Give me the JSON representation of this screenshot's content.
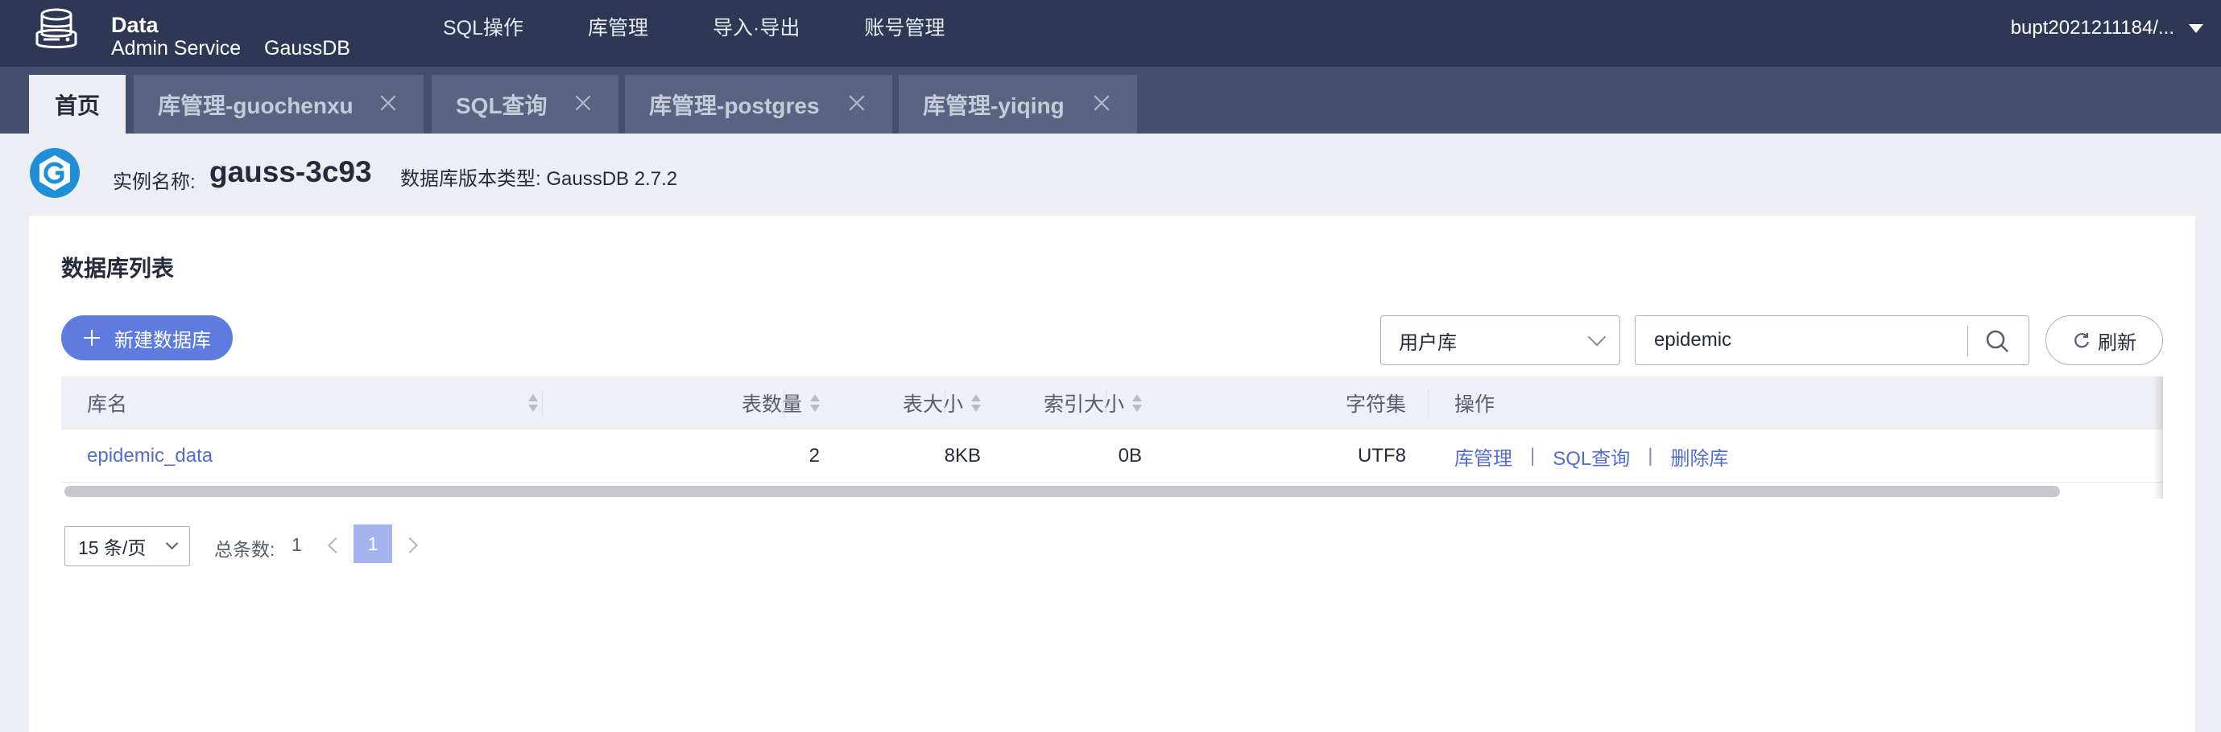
{
  "header": {
    "logo_line1": "Data",
    "logo_line2": "Admin Service",
    "product": "GaussDB",
    "nav": [
      {
        "label": "SQL操作"
      },
      {
        "label": "库管理"
      },
      {
        "label": "导入·导出"
      },
      {
        "label": "账号管理"
      }
    ],
    "user": "bupt2021211184/..."
  },
  "tabs": [
    {
      "label": "首页",
      "active": true
    },
    {
      "label": "库管理-guochenxu"
    },
    {
      "label": "SQL查询"
    },
    {
      "label": "库管理-postgres"
    },
    {
      "label": "库管理-yiqing"
    }
  ],
  "instance": {
    "name_label": "实例名称:",
    "name": "gauss-3c93",
    "version": "数据库版本类型: GaussDB 2.7.2"
  },
  "card": {
    "title": "数据库列表",
    "new_button": "新建数据库",
    "type_filter": "用户库",
    "search_value": "epidemic",
    "refresh": "刷新"
  },
  "table": {
    "columns": [
      "库名",
      "表数量",
      "表大小",
      "索引大小",
      "字符集",
      "操作"
    ],
    "rows": [
      {
        "name": "epidemic_data",
        "tables": "2",
        "size": "8KB",
        "index_size": "0B",
        "charset": "UTF8",
        "actions": [
          "库管理",
          "SQL查询",
          "删除库"
        ]
      }
    ]
  },
  "pagination": {
    "page_size": "15 条/页",
    "total_label": "总条数:",
    "total": "1",
    "current_page": "1"
  },
  "colors": {
    "topbar": "#2e3854",
    "tabstrip": "#454e6b",
    "primary": "#5e7ce0",
    "link": "#526ecc"
  },
  "icons": [
    "database-logo-icon",
    "gaussdb-logo-icon",
    "caret-down-icon",
    "close-icon",
    "plus-icon",
    "chevron-down-icon",
    "search-icon",
    "refresh-icon",
    "sort-icon",
    "chevron-left-icon",
    "chevron-right-icon"
  ]
}
